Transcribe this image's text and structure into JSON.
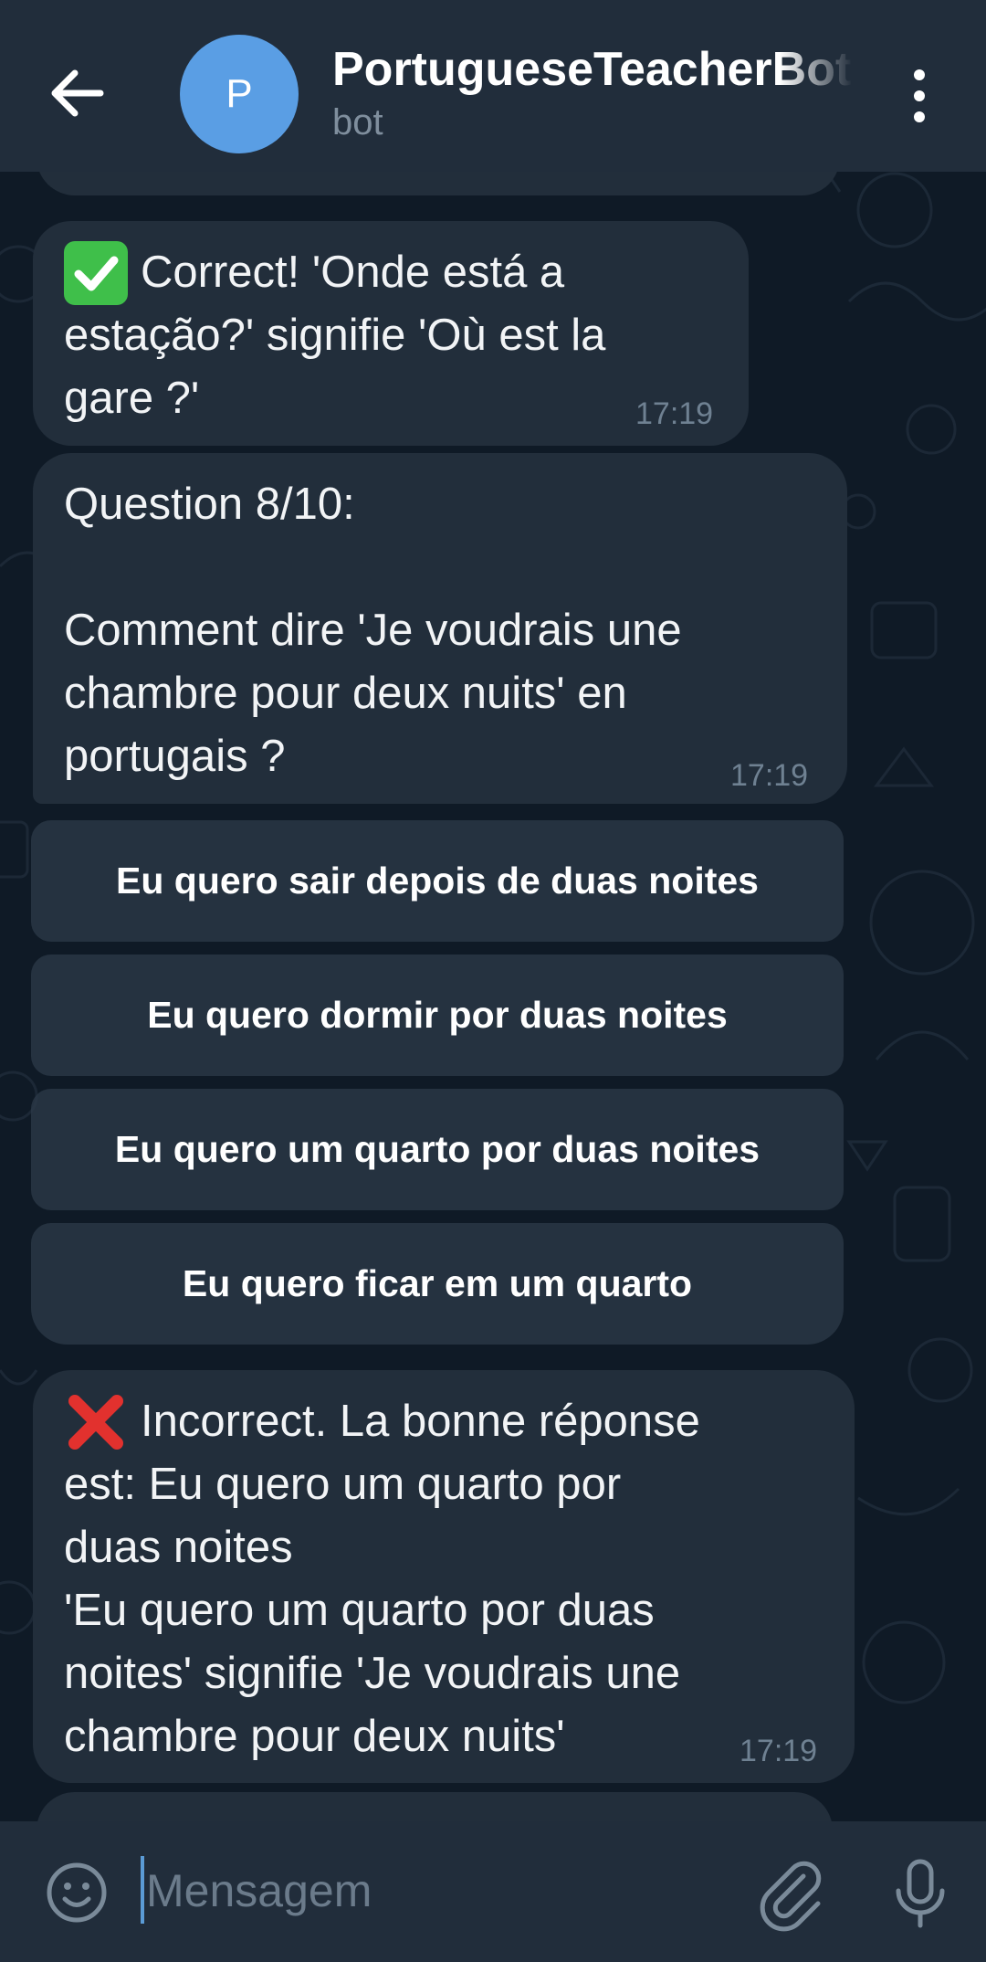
{
  "header": {
    "title": "PortugueseTeacherBot",
    "subtitle": "bot",
    "avatar_letter": "P",
    "back_icon": "arrow-left-icon",
    "menu_icon": "more-vertical-icon"
  },
  "messages": [
    {
      "text": "Correct! 'Onde está a\nestação?' signifie 'Où est la\ngare ?'",
      "emoji": "check-mark-icon",
      "time": "17:19"
    },
    {
      "text": "Question 8/10:\n\nComment dire 'Je voudrais une\nchambre pour deux nuits' en\nportugais ?",
      "time": "17:19"
    },
    {
      "text": "Incorrect. La bonne réponse\nest: Eu quero um quarto por\nduas noites\n'Eu quero um quarto por duas\nnoites' signifie 'Je voudrais une\nchambre pour deux nuits'",
      "emoji": "cross-mark-icon",
      "time": "17:19"
    }
  ],
  "keyboard": {
    "options": [
      "Eu quero sair depois de duas noites",
      "Eu quero dormir por duas noites",
      "Eu quero um quarto por duas noites",
      "Eu quero ficar em um quarto"
    ]
  },
  "input": {
    "placeholder": "Mensagem",
    "value": "",
    "emoji_icon": "smiley-icon",
    "attach_icon": "paperclip-icon",
    "mic_icon": "microphone-icon"
  },
  "colors": {
    "header_bg": "#212d3b",
    "chat_bg": "#0f1a26",
    "bubble_bg": "#222e3b",
    "avatar_bg": "#5a9ee4",
    "check_green": "#3fbf4a",
    "cross_red": "#e2312e",
    "caret_blue": "#5b9bd5"
  }
}
